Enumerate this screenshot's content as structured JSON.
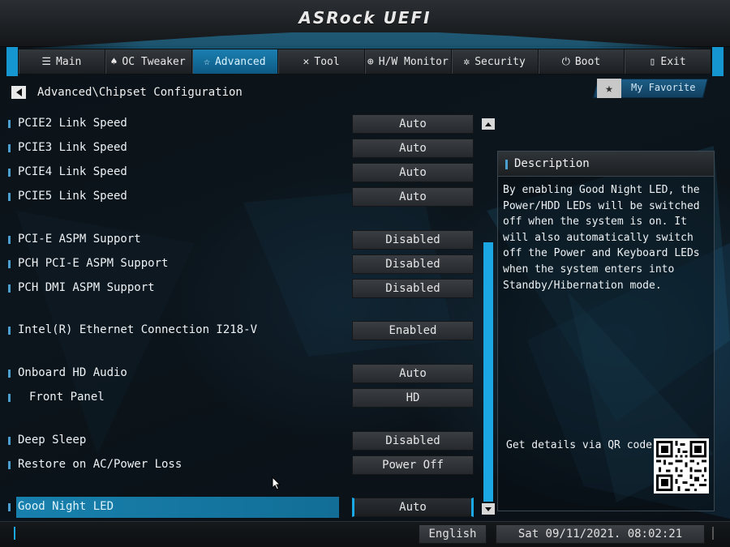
{
  "header": {
    "logo_text": "ASRock UEFI"
  },
  "tabs": [
    {
      "label": "Main",
      "icon": "menu-icon",
      "active": false
    },
    {
      "label": "OC Tweaker",
      "icon": "rocket-icon",
      "active": false
    },
    {
      "label": "Advanced",
      "icon": "star-icon",
      "active": true
    },
    {
      "label": "Tool",
      "icon": "tool-icon",
      "active": false
    },
    {
      "label": "H/W Monitor",
      "icon": "monitor-icon",
      "active": false
    },
    {
      "label": "Security",
      "icon": "shield-icon",
      "active": false
    },
    {
      "label": "Boot",
      "icon": "power-icon",
      "active": false
    },
    {
      "label": "Exit",
      "icon": "exit-icon",
      "active": false
    }
  ],
  "breadcrumb": "Advanced\\Chipset Configuration",
  "favorite": {
    "label": "My Favorite"
  },
  "settings": [
    {
      "label": "PCIE2 Link Speed",
      "value": "Auto"
    },
    {
      "label": "PCIE3 Link Speed",
      "value": "Auto"
    },
    {
      "label": "PCIE4 Link Speed",
      "value": "Auto"
    },
    {
      "label": "PCIE5 Link Speed",
      "value": "Auto"
    },
    {
      "label": "PCI-E ASPM Support",
      "value": "Disabled"
    },
    {
      "label": "PCH PCI-E ASPM Support",
      "value": "Disabled"
    },
    {
      "label": "PCH DMI ASPM Support",
      "value": "Disabled"
    },
    {
      "label": "Intel(R) Ethernet Connection I218-V",
      "value": "Enabled"
    },
    {
      "label": "Onboard HD Audio",
      "value": "Auto"
    },
    {
      "label": "Front Panel",
      "value": "HD"
    },
    {
      "label": "Deep Sleep",
      "value": "Disabled"
    },
    {
      "label": "Restore on AC/Power Loss",
      "value": "Power Off"
    },
    {
      "label": "Good Night LED",
      "value": "Auto"
    }
  ],
  "description": {
    "title": "Description",
    "text": "By enabling Good Night LED, the Power/HDD LEDs will be switched off when the system is on. It will also automatically switch off the Power and Keyboard LEDs when the system enters into Standby/Hibernation mode.",
    "qr_label": "Get details via QR code"
  },
  "footer": {
    "language": "English",
    "datetime": "Sat 09/11/2021. 08:02:21"
  },
  "colors": {
    "accent": "#1aa7e4",
    "selected_row": "#1880ad"
  }
}
